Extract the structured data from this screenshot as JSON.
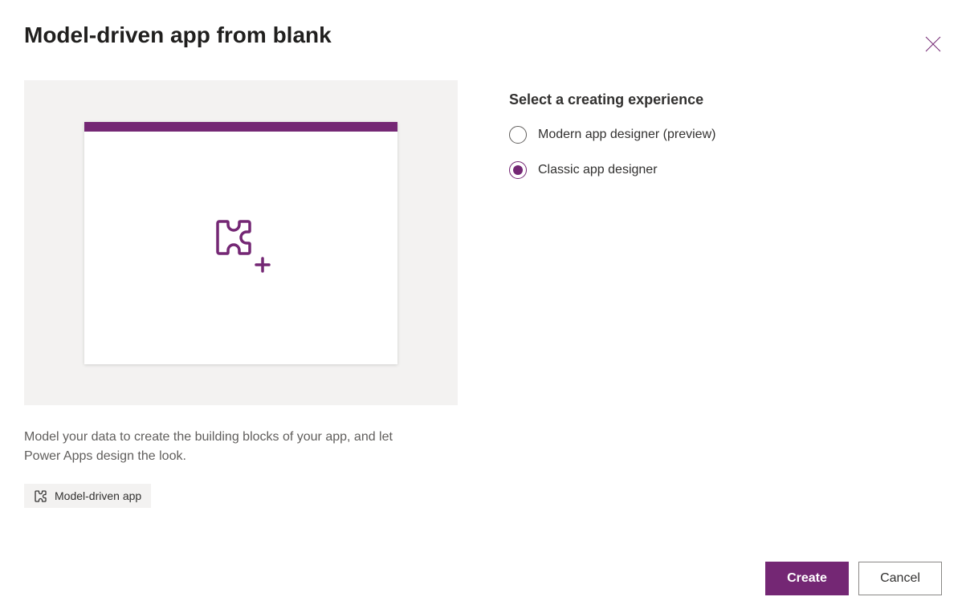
{
  "dialog": {
    "title": "Model-driven app from blank",
    "description": "Model your data to create the building blocks of your app, and let Power Apps design the look.",
    "tag_label": "Model-driven app"
  },
  "selector": {
    "heading": "Select a creating experience",
    "options": {
      "modern": "Modern app designer (preview)",
      "classic": "Classic app designer"
    },
    "selected": "classic"
  },
  "actions": {
    "create": "Create",
    "cancel": "Cancel"
  },
  "colors": {
    "accent": "#742774"
  }
}
